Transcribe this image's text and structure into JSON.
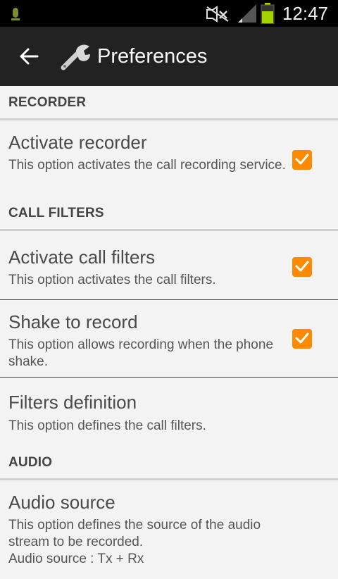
{
  "status_bar": {
    "time": "12:47",
    "icons": [
      "notification-icon",
      "mute-icon",
      "signal-icon",
      "battery-icon"
    ],
    "battery_color": "#a4d300"
  },
  "action_bar": {
    "title": "Preferences",
    "back_icon": "back-arrow-icon",
    "app_icon": "wrench-icon",
    "background": "#222222"
  },
  "accent_color": "#ff8a00",
  "sections": [
    {
      "header": "RECORDER",
      "items": [
        {
          "title": "Activate recorder",
          "summary": "This option activates the call recording service.",
          "checked": true
        }
      ]
    },
    {
      "header": "CALL FILTERS",
      "items": [
        {
          "title": "Activate call filters",
          "summary": "This option activates the call filters.",
          "checked": true
        },
        {
          "title": "Shake to record",
          "summary": "This option allows recording when the phone shake.",
          "checked": true
        },
        {
          "title": "Filters definition",
          "summary": "This option defines the call filters."
        }
      ]
    },
    {
      "header": "AUDIO",
      "items": [
        {
          "title": "Audio source",
          "summary": "This option defines the source of the audio stream to be recorded.",
          "summary_extra": "Audio source : Tx + Rx"
        }
      ]
    }
  ]
}
